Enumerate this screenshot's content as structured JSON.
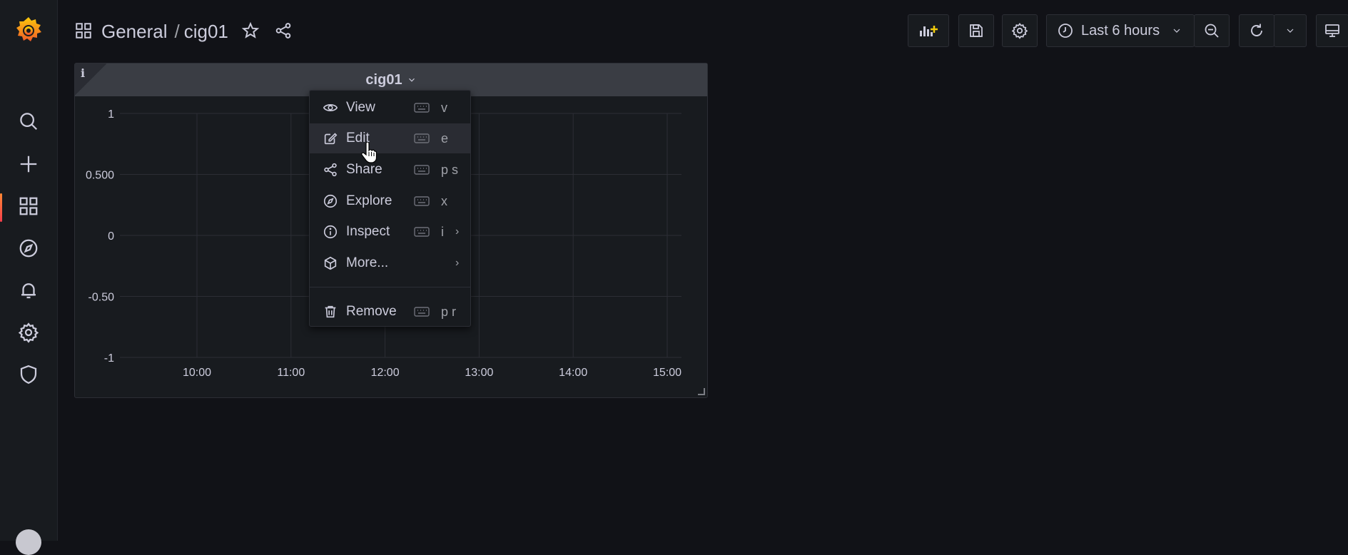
{
  "sidebar": {
    "logo": "grafana-logo",
    "items": [
      {
        "name": "search-icon"
      },
      {
        "name": "plus-icon"
      },
      {
        "name": "dashboards-icon",
        "active": true
      },
      {
        "name": "explore-compass-icon"
      },
      {
        "name": "alerting-bell-icon"
      },
      {
        "name": "configuration-gear-icon"
      },
      {
        "name": "server-admin-shield-icon"
      }
    ]
  },
  "header": {
    "folder": "General",
    "separator": "/",
    "dashboard_title": "cig01"
  },
  "toolbar": {
    "time_range_label": "Last 6 hours",
    "accent": "#f2cc0c"
  },
  "panel": {
    "title": "cig01",
    "info_glyph": "i"
  },
  "chart_data": {
    "type": "line",
    "y_ticks": [
      "1",
      "0.500",
      "0",
      "-0.50",
      "-1"
    ],
    "x_ticks": [
      "10:00",
      "11:00",
      "12:00",
      "13:00",
      "14:00",
      "15:00"
    ],
    "ylim": [
      -1,
      1
    ],
    "grid": true,
    "series": []
  },
  "menu": {
    "items": [
      {
        "label": "View",
        "key": "v",
        "icon": "eye-icon"
      },
      {
        "label": "Edit",
        "key": "e",
        "icon": "edit-icon"
      },
      {
        "label": "Share",
        "key": "p s",
        "icon": "share-icon"
      },
      {
        "label": "Explore",
        "key": "x",
        "icon": "compass-icon"
      },
      {
        "label": "Inspect",
        "key": "i",
        "icon": "info-circle-icon",
        "submenu": true
      },
      {
        "label": "More...",
        "key": "",
        "icon": "cube-icon",
        "submenu": true
      },
      {
        "label": "Remove",
        "key": "p r",
        "icon": "trash-icon"
      }
    ],
    "submenu_glyph": "›"
  }
}
